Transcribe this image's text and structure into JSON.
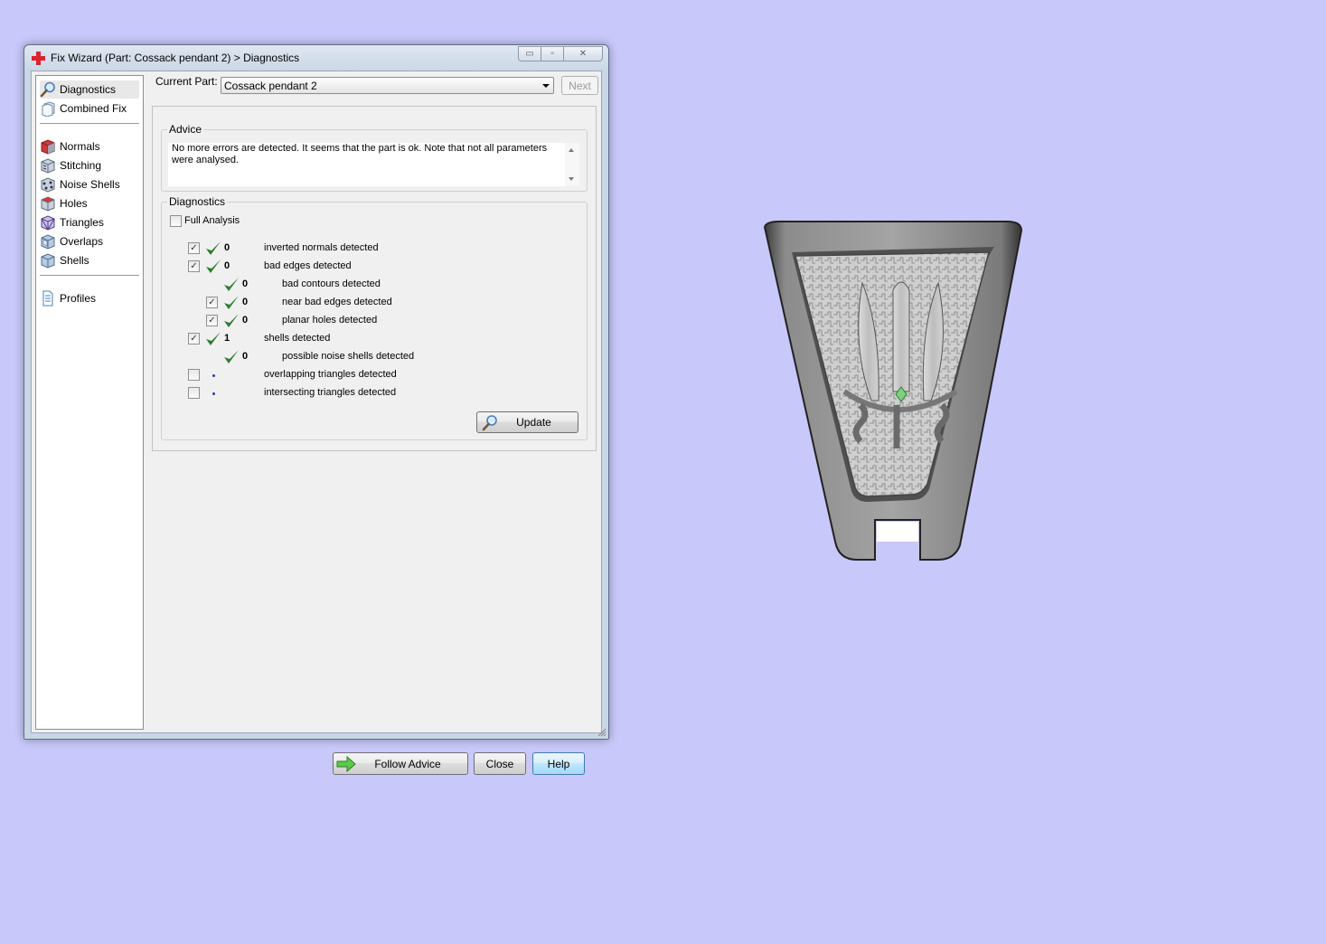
{
  "window": {
    "title": "Fix Wizard (Part: Cossack pendant 2) > Diagnostics",
    "caption_buttons": {
      "minimize": "▭",
      "maximize": "▫",
      "close": "✕"
    }
  },
  "nav": {
    "items": [
      {
        "label": "Diagnostics",
        "icon": "magnifier-icon",
        "selected": true
      },
      {
        "label": "Combined Fix",
        "icon": "combined-fix-icon"
      },
      {
        "label": "Normals",
        "icon": "normals-cube-icon"
      },
      {
        "label": "Stitching",
        "icon": "stitching-cube-icon"
      },
      {
        "label": "Noise Shells",
        "icon": "noise-shells-cube-icon"
      },
      {
        "label": "Holes",
        "icon": "holes-cube-icon"
      },
      {
        "label": "Triangles",
        "icon": "triangles-cube-icon"
      },
      {
        "label": "Overlaps",
        "icon": "overlaps-cube-icon"
      },
      {
        "label": "Shells",
        "icon": "shells-cube-icon"
      },
      {
        "label": "Profiles",
        "icon": "profiles-document-icon"
      }
    ]
  },
  "current_part": {
    "label": "Current Part:",
    "value": "Cossack pendant 2"
  },
  "next_button": "Next",
  "advice": {
    "title": "Advice",
    "text": "No more errors are detected. It seems that the part is ok. Note that not all parameters were analysed."
  },
  "diagnostics": {
    "title": "Diagnostics",
    "full_analysis": {
      "label": "Full Analysis",
      "checked": false
    },
    "rows": [
      {
        "checkbox": true,
        "checked": true,
        "status": "ok",
        "count": "0",
        "label": "inverted normals detected",
        "indent": 0
      },
      {
        "checkbox": true,
        "checked": true,
        "status": "ok",
        "count": "0",
        "label": "bad edges detected",
        "indent": 0
      },
      {
        "checkbox": false,
        "checked": false,
        "status": "ok",
        "count": "0",
        "label": "bad contours detected",
        "indent": 1
      },
      {
        "checkbox": true,
        "checked": true,
        "status": "ok",
        "count": "0",
        "label": "near bad edges detected",
        "indent": 1
      },
      {
        "checkbox": true,
        "checked": true,
        "status": "ok",
        "count": "0",
        "label": "planar holes detected",
        "indent": 1
      },
      {
        "checkbox": true,
        "checked": true,
        "status": "ok",
        "count": "1",
        "label": "shells detected",
        "indent": 0
      },
      {
        "checkbox": false,
        "checked": false,
        "status": "ok",
        "count": "0",
        "label": "possible noise shells detected",
        "indent": 1
      },
      {
        "checkbox": true,
        "checked": false,
        "status": "pending",
        "count": "",
        "label": "overlapping triangles detected",
        "indent": 0
      },
      {
        "checkbox": true,
        "checked": false,
        "status": "pending",
        "count": "",
        "label": "intersecting triangles detected",
        "indent": 0
      }
    ],
    "update_button": "Update"
  },
  "footer": {
    "follow_advice": "Follow Advice",
    "close": "Close",
    "help": "Help"
  },
  "colors": {
    "desktop": "#c8c8fa",
    "check_green": "#2e7d32",
    "pending_dot": "#2a3ea0",
    "model_gray": "#6e6e6e"
  }
}
